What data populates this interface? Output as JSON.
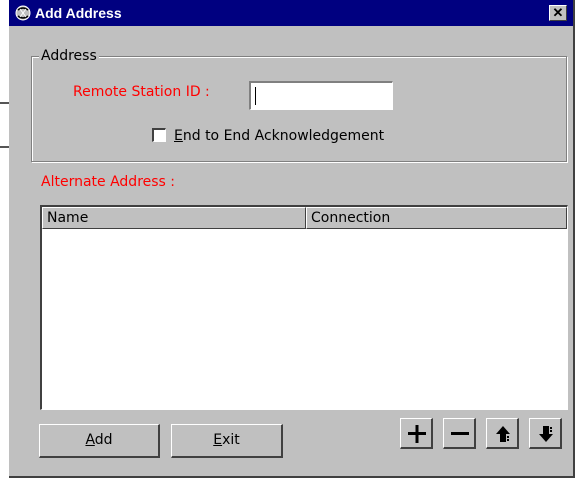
{
  "window": {
    "title": "Add Address",
    "close_icon": "close-icon",
    "app_icon": "app-icon"
  },
  "address_group": {
    "legend": "Address",
    "remote_station_label": "Remote Station ID :",
    "remote_station_value": "",
    "e2e_checkbox": {
      "label_first": "E",
      "label_rest": "nd to End Acknowledgement",
      "checked": false
    }
  },
  "alternate": {
    "label": "Alternate Address :",
    "columns": [
      "Name",
      "Connection"
    ],
    "rows": []
  },
  "buttons": {
    "add_first": "A",
    "add_rest": "dd",
    "exit_first": "E",
    "exit_rest": "xit"
  },
  "toolbar_icons": [
    "plus-icon",
    "minus-icon",
    "arrow-up-icon",
    "arrow-down-icon"
  ],
  "colors": {
    "titlebar": "#000080",
    "face": "#c0c0c0",
    "label_red": "#ff0000"
  }
}
